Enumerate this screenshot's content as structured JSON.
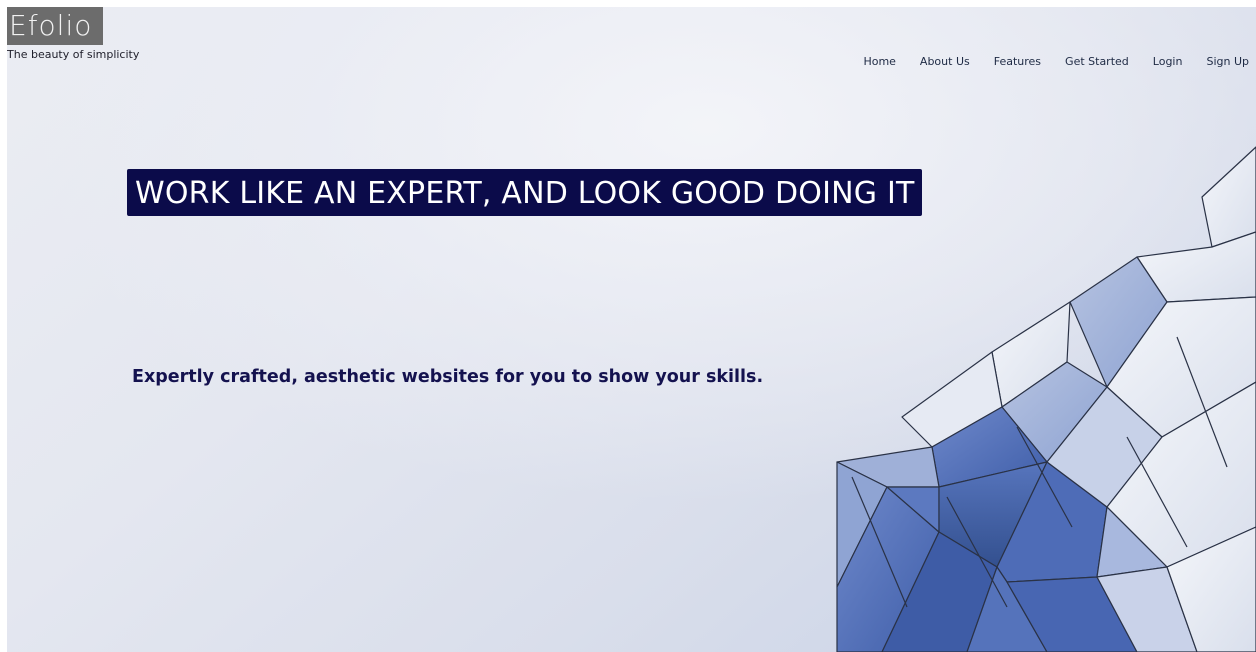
{
  "brand": {
    "logo_text": "Efolio",
    "tagline": "The beauty of simplicity"
  },
  "nav": {
    "items": [
      {
        "label": "Home"
      },
      {
        "label": "About Us"
      },
      {
        "label": "Features"
      },
      {
        "label": "Get Started"
      },
      {
        "label": "Login"
      },
      {
        "label": "Sign Up"
      }
    ]
  },
  "hero": {
    "headline": "WORK LIKE AN EXPERT, AND LOOK GOOD DOING IT",
    "subheadline": "Expertly crafted, aesthetic websites for you to show your skills."
  },
  "colors": {
    "headline_bg": "#0b0b4a",
    "subheadline_text": "#14124f",
    "logo_bg": "#6c6c6c",
    "facet_dark": "#4a67b4",
    "facet_light": "#eef1f7"
  },
  "illustration": {
    "icon": "geometric-glass-facade-image"
  }
}
